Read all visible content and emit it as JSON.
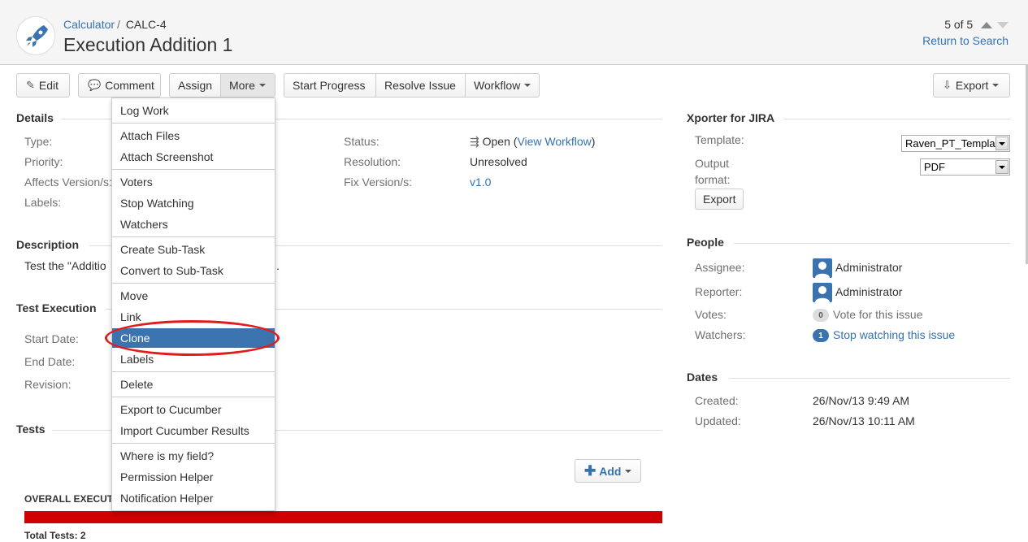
{
  "header": {
    "project": "Calculator",
    "separator": "/",
    "issue_key": "CALC-4",
    "title": "Execution Addition 1",
    "pager": "5 of 5",
    "return_link": "Return to Search"
  },
  "toolbar": {
    "edit": "Edit",
    "comment": "Comment",
    "assign": "Assign",
    "more": "More",
    "start_progress": "Start Progress",
    "resolve_issue": "Resolve Issue",
    "workflow": "Workflow",
    "export": "Export"
  },
  "details": {
    "title": "Details",
    "type_label": "Type:",
    "priority_label": "Priority:",
    "affects_label": "Affects Version/s:",
    "labels_label": "Labels:",
    "status_label": "Status:",
    "status_value": "Open",
    "status_paren_open": "(",
    "view_workflow": "View Workflow",
    "status_paren_close": ")",
    "resolution_label": "Resolution:",
    "resolution_value": "Unresolved",
    "fix_label": "Fix Version/s:",
    "fix_value": "v1.0"
  },
  "description": {
    "title": "Description",
    "text_start": "Test the \"Additio",
    "text_end": "."
  },
  "test_execution": {
    "title": "Test Execution",
    "start_label": "Start Date:",
    "end_label": "End Date:",
    "revision_label": "Revision:"
  },
  "tests": {
    "title": "Tests",
    "add": "Add",
    "overall": "OVERALL EXECUTI",
    "total": "Total Tests: 2",
    "bar_color": "#d00000"
  },
  "more_menu": {
    "items": [
      "Log Work",
      "Attach Files",
      "Attach Screenshot",
      "Voters",
      "Stop Watching",
      "Watchers",
      "Create Sub-Task",
      "Convert to Sub-Task",
      "Move",
      "Link",
      "Clone",
      "Labels",
      "Delete",
      "Export to Cucumber",
      "Import Cucumber Results",
      "Where is my field?",
      "Permission Helper",
      "Notification Helper"
    ],
    "highlighted": "Clone",
    "highlight_color": "#3b73af",
    "annotation_color": "#e01c1c"
  },
  "xporter": {
    "title": "Xporter for JIRA",
    "template_label": "Template:",
    "template_value": "Raven_PT_Templa",
    "output_label_1": "Output",
    "output_label_2": "format:",
    "output_value": "PDF",
    "export_button": "Export"
  },
  "people": {
    "title": "People",
    "assignee_label": "Assignee:",
    "assignee_value": "Administrator",
    "reporter_label": "Reporter:",
    "reporter_value": "Administrator",
    "votes_label": "Votes:",
    "votes_count": "0",
    "votes_link": "Vote for this issue",
    "watchers_label": "Watchers:",
    "watchers_count": "1",
    "watchers_link": "Stop watching this issue"
  },
  "dates": {
    "title": "Dates",
    "created_label": "Created:",
    "created_value": "26/Nov/13 9:49 AM",
    "updated_label": "Updated:",
    "updated_value": "26/Nov/13 10:11 AM"
  }
}
